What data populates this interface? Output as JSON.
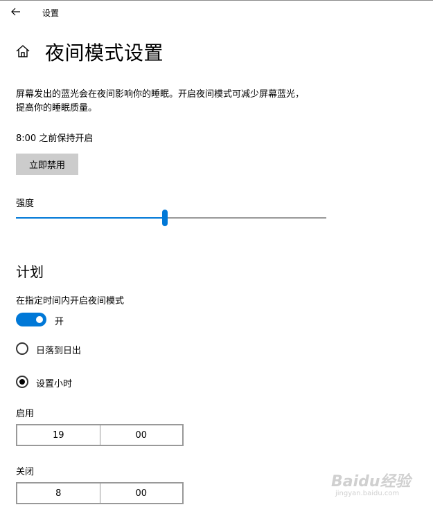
{
  "window": {
    "title": "设置",
    "back_icon": "arrow-left-icon"
  },
  "page": {
    "home_icon": "home-icon",
    "title": "夜间模式设置",
    "description_lines": [
      "屏幕发出的蓝光会在夜间影响你的睡眠。开启夜间模式可减少屏幕蓝光，",
      "提高你的睡眠质量。"
    ],
    "status_text": "8:00 之前保持开启",
    "disable_button_label": "立即禁用"
  },
  "strength": {
    "label": "强度",
    "value_fraction": 0.48
  },
  "schedule": {
    "heading": "计划",
    "toggle_label": "在指定时间内开启夜间模式",
    "toggle_on": true,
    "toggle_state_text": "开",
    "options": [
      {
        "label": "日落到日出",
        "selected": false
      },
      {
        "label": "设置小时",
        "selected": true
      }
    ],
    "on_time": {
      "label": "启用",
      "hour": "19",
      "minute": "00"
    },
    "off_time": {
      "label": "关闭",
      "hour": "8",
      "minute": "00"
    }
  },
  "watermark": {
    "brand": "Baidu经验",
    "url": "jingyan.baidu.com"
  },
  "colors": {
    "accent": "#0078d7",
    "button_bg": "#cccccc",
    "track_rest": "#999999"
  }
}
